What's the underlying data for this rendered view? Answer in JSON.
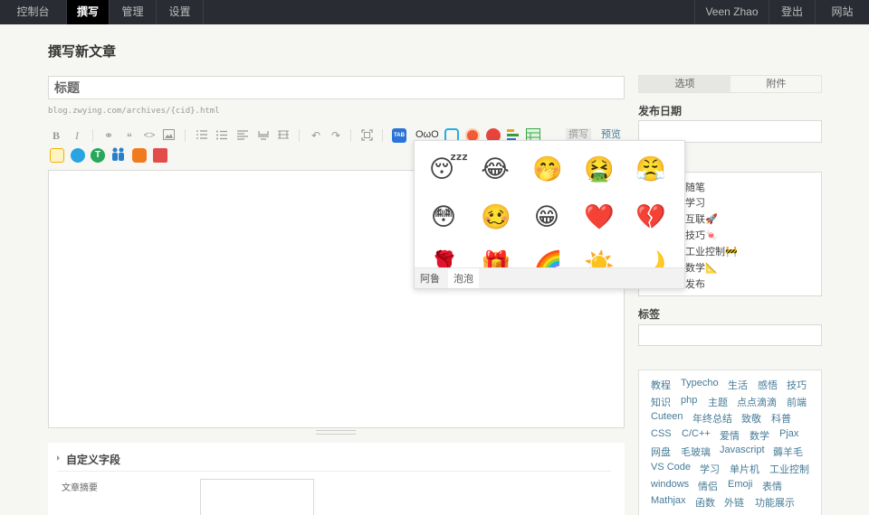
{
  "nav": {
    "left": [
      "控制台",
      "撰写",
      "管理",
      "设置"
    ],
    "right": [
      "Veen Zhao",
      "登出",
      "网站"
    ]
  },
  "page_title": "撰写新文章",
  "title_placeholder": "标题",
  "permalink": "blog.zwying.com/archives/{cid}.html",
  "toolbar": {
    "bold": "B",
    "italic": "I",
    "link": "⚭",
    "quote": "“",
    "code": "<>",
    "undo": "↶",
    "redo": "↷",
    "owo": "OωO",
    "tab_label": "TAB",
    "mode_write": "撰写",
    "mode_preview": "预览"
  },
  "custom_fields": {
    "title": "自定义字段",
    "excerpt_label": "文章摘要"
  },
  "sidebar": {
    "tabs": [
      "选项",
      "附件"
    ],
    "publish_date_label": "发布日期",
    "categories": [
      "随笔",
      "学习",
      "互联🚀",
      "技巧🍬",
      "工业控制🚧",
      "数学📐",
      "发布"
    ],
    "tags_label": "标签",
    "tags": [
      [
        "教程",
        "Typecho",
        "生活",
        "感悟",
        "技巧"
      ],
      [
        "知识",
        "php",
        "主题",
        "点点滴滴",
        "前端"
      ],
      [
        "Cuteen",
        "年终总结",
        "致敬",
        "科普"
      ],
      [
        "CSS",
        "C/C++",
        "爱情",
        "数学",
        "Pjax"
      ],
      [
        "网盘",
        "毛玻璃",
        "Javascript",
        "薅羊毛"
      ],
      [
        "VS Code",
        "学习",
        "单片机",
        "工业控制"
      ],
      [
        "windows",
        "情侣",
        "Emoji",
        "表情"
      ],
      [
        "Mathjax",
        "函数",
        "外链",
        "功能展示"
      ]
    ]
  },
  "emoji_popup": {
    "emojis": [
      "😴",
      "😂",
      "🤭",
      "🤮",
      "😤",
      "😳",
      "🥴",
      "😁",
      "❤️",
      "💔",
      "🌹",
      "🎁",
      "🌈",
      "☀️",
      "🌙"
    ],
    "tabs": [
      "阿鲁",
      "泡泡"
    ],
    "active_tab": 1
  },
  "colors": {
    "accent": "#467b96",
    "nav_bg": "#292d33"
  }
}
